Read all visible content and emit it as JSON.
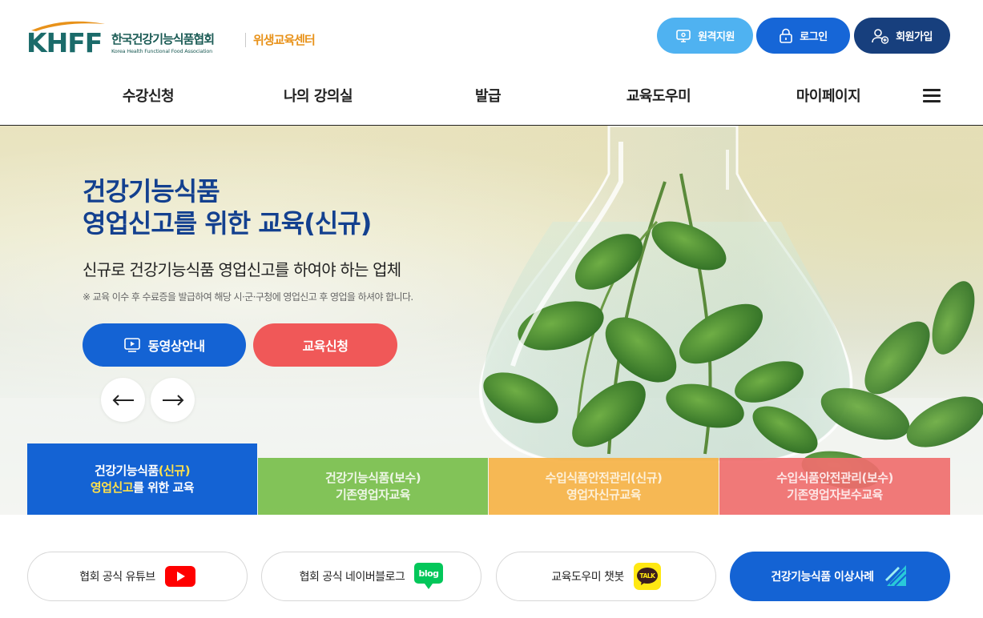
{
  "logo": {
    "mark_text": "KHFF",
    "org_name_ko": "한국건강기능식품협회",
    "org_name_en": "Korea Health Functional Food Association",
    "center_name": "위생교육센터"
  },
  "top_buttons": {
    "remote": "원격지원",
    "login": "로그인",
    "join": "회원가입"
  },
  "nav": {
    "items": [
      "수강신청",
      "나의 강의실",
      "발급",
      "교육도우미",
      "마이페이지"
    ]
  },
  "hero": {
    "title_line1": "건강기능식품",
    "title_line2": "영업신고를 위한 교육(신규)",
    "subtitle": "신규로 건강기능식품 영업신고를 하여야 하는 업체",
    "note": "※ 교육 이수 후 수료증을 발급하여 해당 시·군·구청에 영업신고 후 영업을 하셔야 합니다.",
    "video_button": "동영상안내",
    "apply_button": "교육신청"
  },
  "course_tabs": [
    {
      "line1_a": "건강기능식품",
      "line1_b": "(신규)",
      "line2_a": "영업신고",
      "line2_b": "를 위한 교육"
    },
    {
      "line1": "건강기능식품(보수)",
      "line2": "기존영업자교육"
    },
    {
      "line1": "수입식품안전관리(신규)",
      "line2": "영업자신규교육"
    },
    {
      "line1": "수입식품안전관리(보수)",
      "line2": "기존영업자보수교육"
    }
  ],
  "links": {
    "youtube": "협회 공식 유튜브",
    "blog": "협회 공식 네이버블로그",
    "blog_badge": "blog",
    "chatbot": "교육도우미 챗봇",
    "chatbot_badge": "TALK",
    "cases": "건강기능식품 이상사례"
  },
  "colors": {
    "primary": "#1463d4",
    "navy": "#173f7d",
    "sky": "#4fb2f1",
    "red": "#f05858",
    "green": "#78be4b",
    "orange": "#f6b246",
    "pink": "#f06e6e",
    "brand_teal": "#1b6b6a",
    "brand_orange": "#e8921a"
  },
  "icons": {
    "remote": "remote-support-icon",
    "login": "lock-icon",
    "join": "user-add-icon",
    "menu": "hamburger-menu-icon",
    "video": "video-play-icon",
    "prev": "arrow-left-icon",
    "next": "arrow-right-icon",
    "youtube": "youtube-icon",
    "blog": "naver-blog-icon",
    "chatbot": "kakao-talk-icon",
    "cases": "report-icon"
  }
}
